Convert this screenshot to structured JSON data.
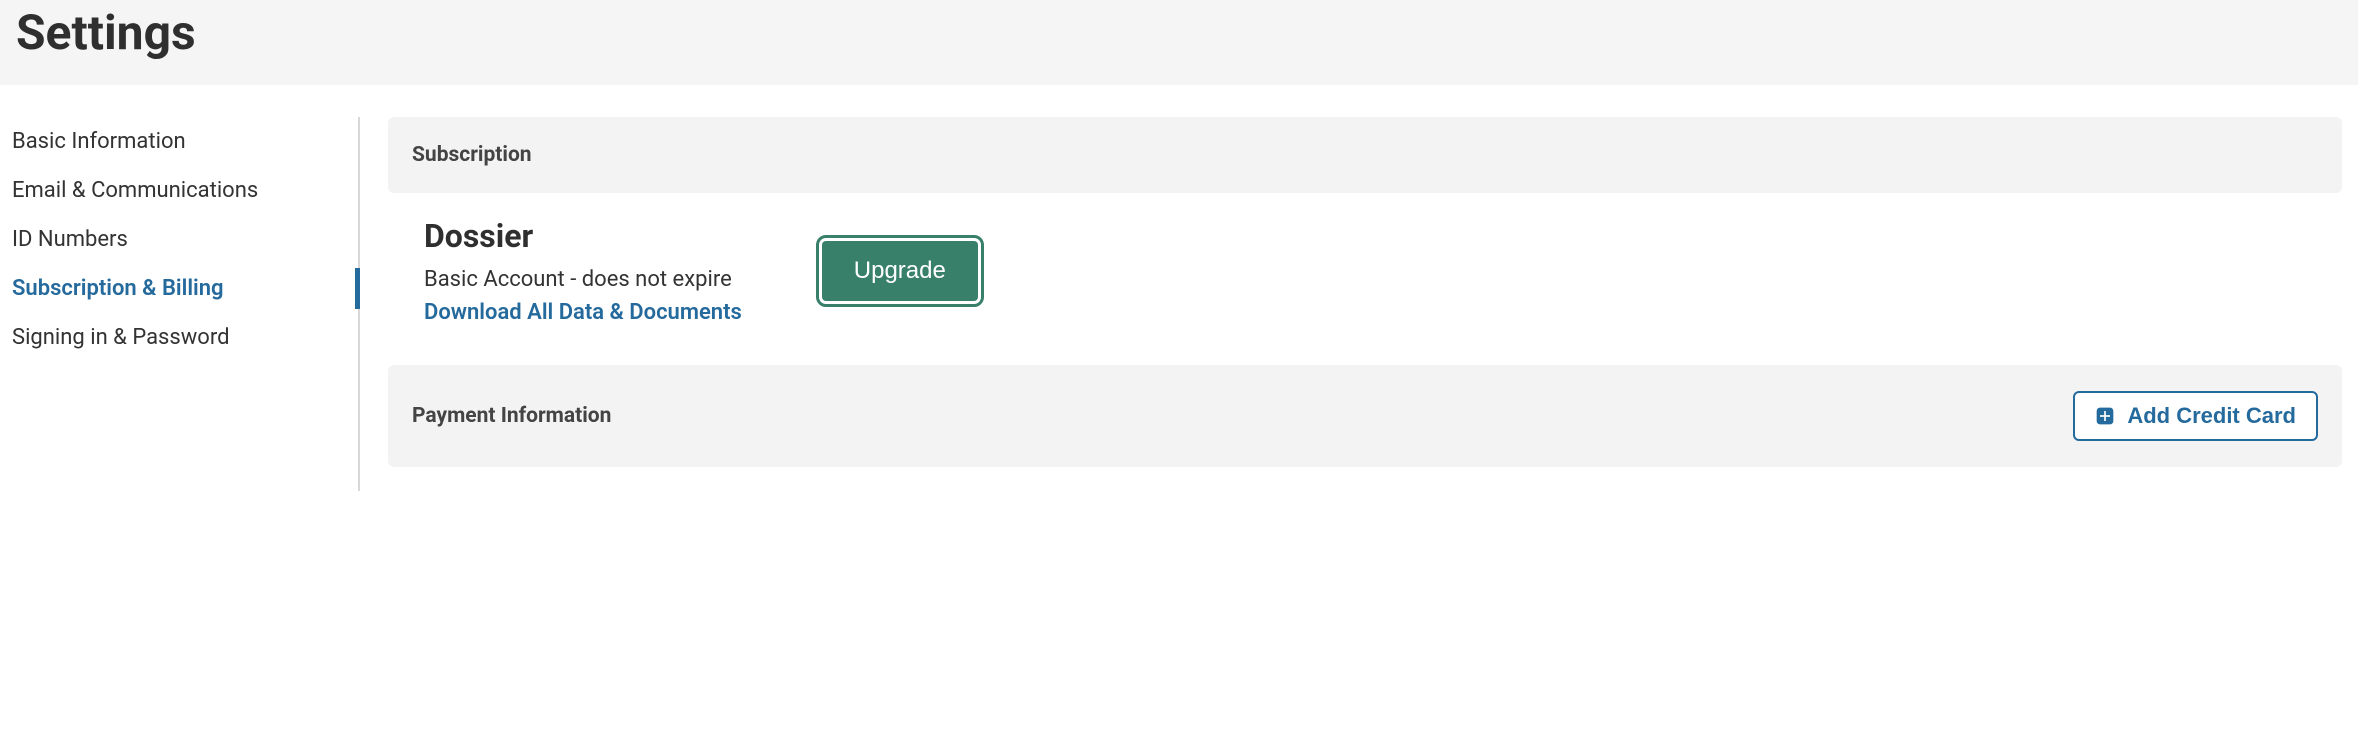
{
  "page": {
    "title": "Settings"
  },
  "sidebar": {
    "items": [
      {
        "label": "Basic Information",
        "active": false
      },
      {
        "label": "Email & Communications",
        "active": false
      },
      {
        "label": "ID Numbers",
        "active": false
      },
      {
        "label": "Subscription & Billing",
        "active": true
      },
      {
        "label": "Signing in & Password",
        "active": false
      }
    ]
  },
  "subscription": {
    "section_title": "Subscription",
    "product_name": "Dossier",
    "account_status": "Basic Account - does not expire",
    "download_link_label": "Download All Data & Documents",
    "upgrade_button_label": "Upgrade"
  },
  "payment": {
    "section_title": "Payment Information",
    "add_card_label": "Add Credit Card"
  }
}
